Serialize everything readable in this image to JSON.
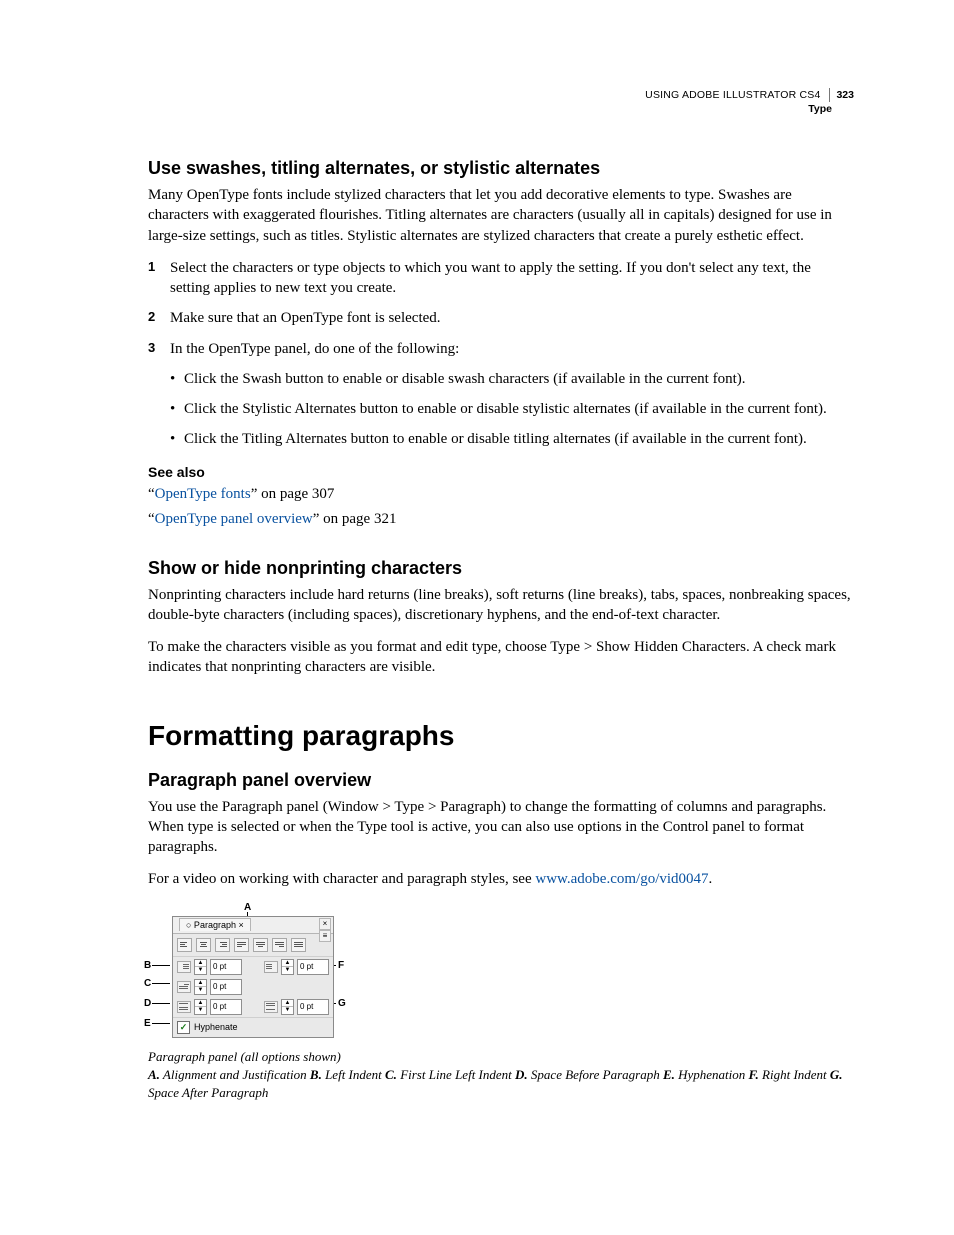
{
  "header": {
    "doc_title": "USING ADOBE ILLUSTRATOR CS4",
    "page_number": "323",
    "chapter": "Type"
  },
  "sec1": {
    "title": "Use swashes, titling alternates, or stylistic alternates",
    "intro": "Many OpenType fonts include stylized characters that let you add decorative elements to type. Swashes are characters with exaggerated flourishes. Titling alternates are characters (usually all in capitals) designed for use in large-size settings, such as titles. Stylistic alternates are stylized characters that create a purely esthetic effect.",
    "step1": "Select the characters or type objects to which you want to apply the setting. If you don't select any text, the setting applies to new text you create.",
    "step2": "Make sure that an OpenType font is selected.",
    "step3": "In the OpenType panel, do one of the following:",
    "b1": "Click the Swash button to enable or disable swash characters (if available in the current font).",
    "b2": "Click the Stylistic Alternates button to enable or disable stylistic alternates (if available in the current font).",
    "b3": "Click the Titling Alternates button to enable or disable titling alternates (if available in the current font).",
    "seealso_h": "See also",
    "sa1_pre": "“",
    "sa1_link": "OpenType fonts",
    "sa1_post": "” on page 307",
    "sa2_pre": "“",
    "sa2_link": "OpenType panel overview",
    "sa2_post": "” on page 321"
  },
  "sec2": {
    "title": "Show or hide nonprinting characters",
    "p1": "Nonprinting characters include hard returns (line breaks), soft returns (line breaks), tabs, spaces, nonbreaking spaces, double-byte characters (including spaces), discretionary hyphens, and the end-of-text character.",
    "p2": "To make the characters visible as you format and edit type, choose Type > Show Hidden Characters. A check mark indicates that nonprinting characters are visible."
  },
  "h1": "Formatting paragraphs",
  "sec3": {
    "title": "Paragraph panel overview",
    "p1": "You use the Paragraph panel (Window > Type > Paragraph) to change the formatting of columns and paragraphs. When type is selected or when the Type tool is active, you can also use options in the Control panel to format paragraphs.",
    "p2_pre": "For a video on working with character and paragraph styles, see ",
    "p2_link": "www.adobe.com/go/vid0047",
    "p2_post": "."
  },
  "panel": {
    "tab_label": "○ Paragraph ×",
    "val": "0 pt",
    "hyphenate": "Hyphenate"
  },
  "callouts": {
    "A": "A",
    "B": "B",
    "C": "C",
    "D": "D",
    "E": "E",
    "F": "F",
    "G": "G"
  },
  "figcap": {
    "line1": "Paragraph panel (all options shown)",
    "A_k": "A.",
    "A_v": " Alignment and Justification  ",
    "B_k": "B.",
    "B_v": " Left Indent  ",
    "C_k": "C.",
    "C_v": " First Line Left Indent  ",
    "D_k": "D.",
    "D_v": " Space Before Paragraph  ",
    "E_k": "E.",
    "E_v": " Hyphenation  ",
    "F_k": "F.",
    "F_v": " Right Indent  ",
    "G_k": "G.",
    "G_v": " Space After Paragraph"
  }
}
